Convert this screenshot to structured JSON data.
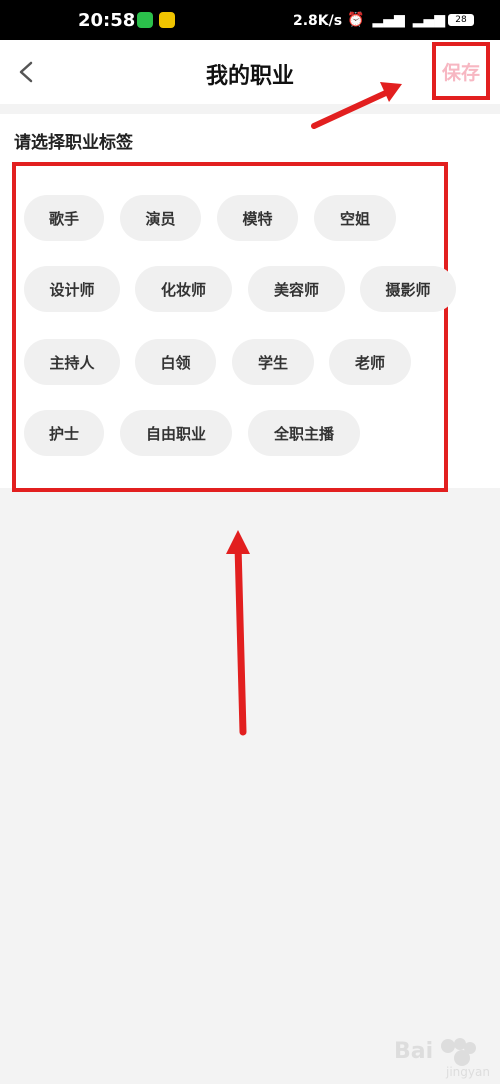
{
  "status_bar": {
    "time": "20:58",
    "network_speed": "2.8K/s",
    "battery": "28"
  },
  "header": {
    "title": "我的职业",
    "save_label": "保存"
  },
  "section": {
    "title": "请选择职业标签"
  },
  "tags": [
    "歌手",
    "演员",
    "模特",
    "空姐",
    "设计师",
    "化妆师",
    "美容师",
    "摄影师",
    "主持人",
    "白领",
    "学生",
    "老师",
    "护士",
    "自由职业",
    "全职主播"
  ],
  "colors": {
    "accent": "#e21f1f",
    "save_text": "#f7b7c2",
    "tag_bg": "#f0f0f0"
  }
}
